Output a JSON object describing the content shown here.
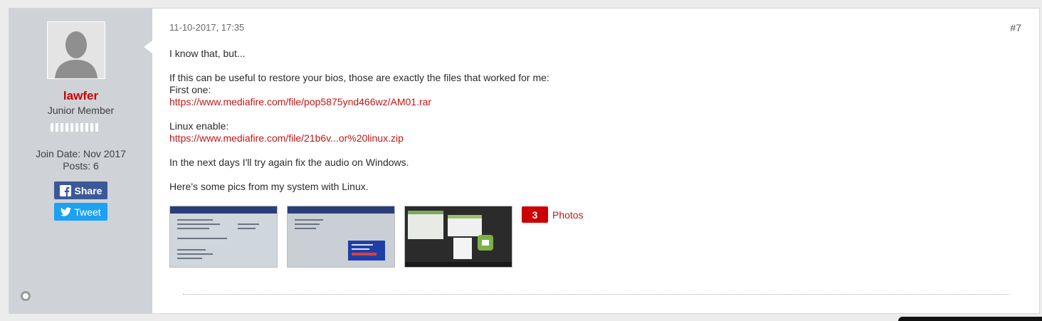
{
  "user": {
    "avatar_icon": "default-avatar-silhouette-icon",
    "username": "lawfer",
    "title": "Junior Member",
    "reputation_segments": 10,
    "join_date": "Join Date: Nov 2017",
    "posts": "Posts: 6",
    "share_label": "Share",
    "share_icon": "facebook-icon",
    "tweet_label": "Tweet",
    "tweet_icon": "twitter-bird-icon",
    "online_status_icon": "offline-status-icon"
  },
  "post": {
    "date": "11-10-2017, 17:35",
    "number": "#7",
    "line1": "I know that, but...",
    "line2": "If this can be useful to restore your bios, those are exactly the files that worked for me:",
    "line3": "First one:",
    "link1": "https://www.mediafire.com/file/pop5875ynd466wz/AM01.rar",
    "line4": "Linux enable:",
    "link2": "https://www.mediafire.com/file/21b6v...or%20linux.zip",
    "line5": "In the next days I'll try again fix the audio on Windows.",
    "line6": "Here's some pics from my system with Linux.",
    "photos_count": "3",
    "photos_label": "Photos"
  },
  "colors": {
    "accent_red": "#cc0000",
    "link_red": "#c41515",
    "facebook_blue": "#3b5998",
    "twitter_blue": "#1da1f2",
    "sidebar_gray": "#cfd2d6"
  }
}
